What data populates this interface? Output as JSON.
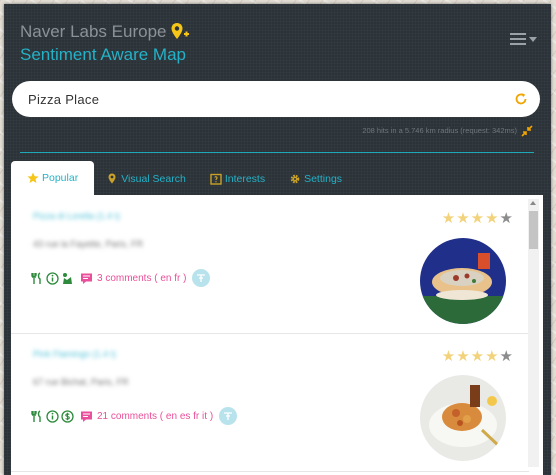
{
  "header": {
    "title": "Naver Labs Europe",
    "subtitle": "Sentiment Aware Map"
  },
  "search": {
    "value": "Pizza Place"
  },
  "hits_text": "208 hits in a 5.746 km radius (request: 342ms)",
  "tabs": [
    {
      "label": "Popular",
      "icon": "star-icon"
    },
    {
      "label": "Visual Search",
      "icon": "camera-icon"
    },
    {
      "label": "Interests",
      "icon": "calendar-icon"
    },
    {
      "label": "Settings",
      "icon": "gear-icon"
    }
  ],
  "results": [
    {
      "name": "Pizza di Lorella (1.4 t)",
      "address": "43 rue la Fayette, Paris, FR",
      "rating": 4,
      "max_rating": 5,
      "tags": [
        "cutlery-icon",
        "info-icon",
        "vegetarian-icon"
      ],
      "comments": "3 comments ( en fr )"
    },
    {
      "name": "Pink Flamingo (1.4 t)",
      "address": "67 rue Bichat, Paris, FR",
      "rating": 4,
      "max_rating": 5,
      "tags": [
        "cutlery-icon",
        "info-icon",
        "price-icon"
      ],
      "comments": "21 comments ( en es fr it )"
    }
  ],
  "colors": {
    "accent": "#23b2c7",
    "panel": "#2b3238",
    "comments": "#e94f9a",
    "star_on": "#f2d37c",
    "tag_green": "#2e8b3d",
    "pin": "#f5c518"
  }
}
